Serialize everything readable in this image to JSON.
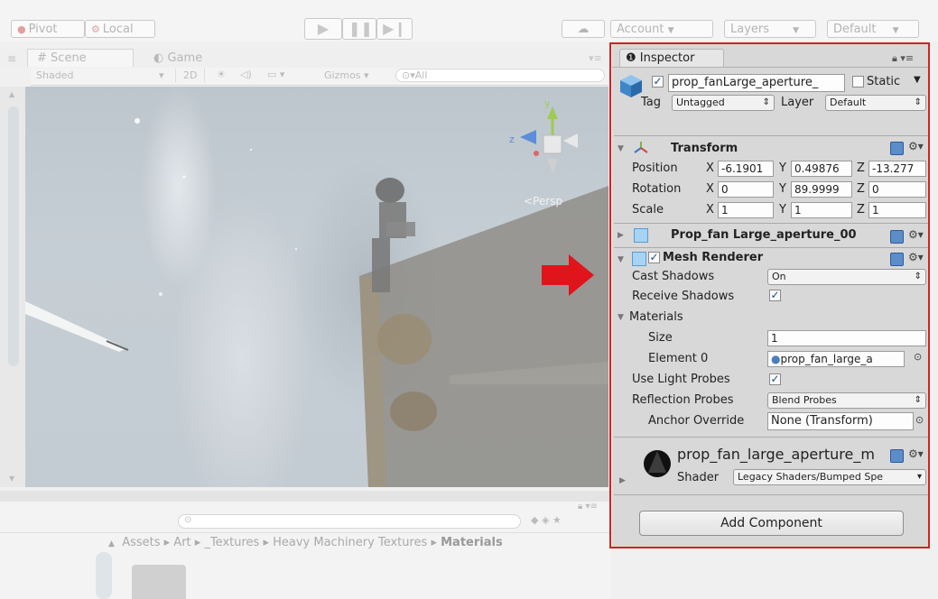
{
  "toolbar": {
    "pivot": "Pivot",
    "local": "Local",
    "account": "Account",
    "layers": "Layers",
    "layout": "Default"
  },
  "scene": {
    "tab_scene": "Scene",
    "tab_game": "Game",
    "shading": "Shaded",
    "mode_2d": "2D",
    "gizmos": "Gizmos",
    "search_placeholder": "All",
    "persp_label": "Persp",
    "gizmo_y": "y",
    "gizmo_z": "z"
  },
  "project": {
    "breadcrumb": [
      "Assets",
      "Art",
      "_Textures",
      "Heavy Machinery Textures",
      "Materials"
    ]
  },
  "inspector": {
    "tab_label": "Inspector",
    "object_name": "prop_fanLarge_aperture_",
    "static_label": "Static",
    "tag_label": "Tag",
    "tag_value": "Untagged",
    "layer_label": "Layer",
    "layer_value": "Default",
    "transform": {
      "title": "Transform",
      "position_label": "Position",
      "rotation_label": "Rotation",
      "scale_label": "Scale",
      "position": {
        "x": "-6.1901",
        "y": "0.49876",
        "z": "-13.277"
      },
      "rotation": {
        "x": "0",
        "y": "89.9999",
        "z": "0"
      },
      "scale": {
        "x": "1",
        "y": "1",
        "z": "1"
      }
    },
    "mesh_filter_title": "Prop_fan Large_aperture_00",
    "mesh_renderer": {
      "title": "Mesh Renderer",
      "cast_shadows_label": "Cast Shadows",
      "cast_shadows_value": "On",
      "receive_shadows_label": "Receive Shadows",
      "materials_label": "Materials",
      "size_label": "Size",
      "size_value": "1",
      "element0_label": "Element 0",
      "element0_value": "prop_fan_large_a",
      "light_probes_label": "Use Light Probes",
      "reflection_probes_label": "Reflection Probes",
      "reflection_probes_value": "Blend Probes",
      "anchor_override_label": "Anchor Override",
      "anchor_override_value": "None (Transform)"
    },
    "material": {
      "name": "prop_fan_large_aperture_m",
      "shader_label": "Shader",
      "shader_value": "Legacy Shaders/Bumped Spe"
    },
    "add_component": "Add Component"
  },
  "colors": {
    "highlight_border": "#d62020",
    "arrow": "#e0141b",
    "inspector_bg": "#d8d8d8"
  },
  "icons": [
    "play-icon",
    "pause-icon",
    "step-icon",
    "cloud-icon",
    "lock-icon",
    "gear-icon",
    "book-icon",
    "cube-icon",
    "transform-icon",
    "mesh-filter-icon",
    "mesh-renderer-icon",
    "material-sphere-icon",
    "object-picker-icon"
  ]
}
